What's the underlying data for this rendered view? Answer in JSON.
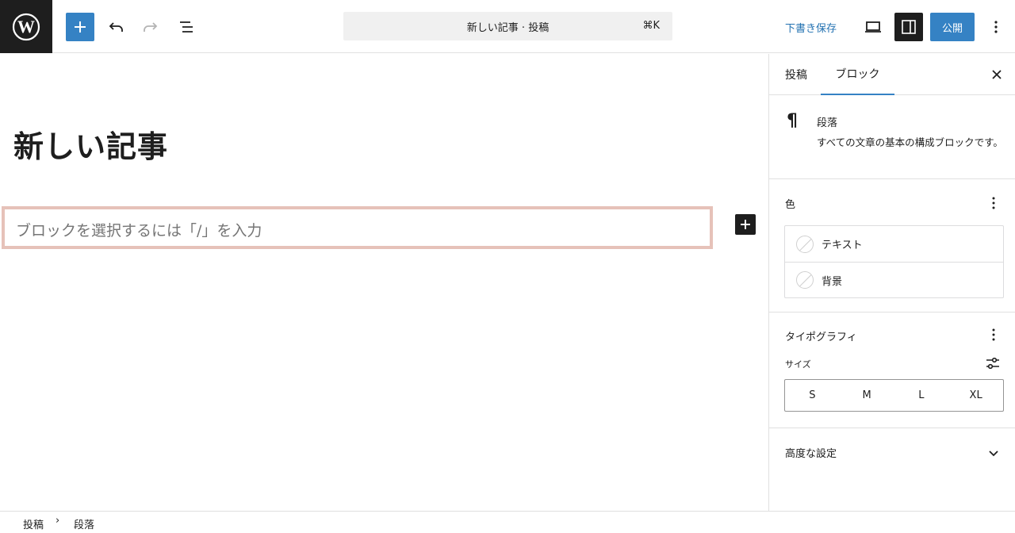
{
  "topbar": {
    "command_title": "新しい記事 · 投稿",
    "command_shortcut": "⌘K",
    "save_draft": "下書き保存",
    "publish": "公開"
  },
  "editor": {
    "post_title": "新しい記事",
    "paragraph_placeholder": "ブロックを選択するには「/」を入力"
  },
  "sidebar": {
    "tabs": [
      {
        "label": "投稿",
        "active": false
      },
      {
        "label": "ブロック",
        "active": true
      }
    ],
    "block_card": {
      "name": "段落",
      "description": "すべての文章の基本の構成ブロックです。"
    },
    "color_panel": {
      "title": "色",
      "items": [
        "テキスト",
        "背景"
      ]
    },
    "typography_panel": {
      "title": "タイポグラフィ",
      "size_label": "サイズ",
      "sizes": [
        "S",
        "M",
        "L",
        "XL"
      ]
    },
    "advanced_panel": {
      "title": "高度な設定"
    }
  },
  "breadcrumb": [
    "投稿",
    "段落"
  ],
  "colors": {
    "accent": "#3582c4",
    "link": "#2271b1",
    "dark": "#1e1e1e",
    "block_outline": "#e6c2b9"
  }
}
